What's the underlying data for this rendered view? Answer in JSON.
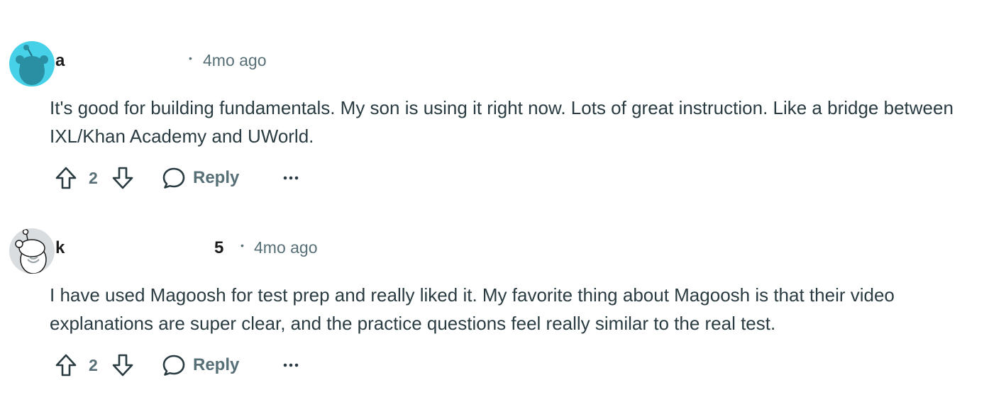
{
  "comments": [
    {
      "author_visible_start": "a",
      "author_visible_end": "",
      "separator": "•",
      "timestamp": "4mo ago",
      "body": "It's good for building fundamentals. My son is using it right now. Lots of great instruction. Like a bridge between IXL/Khan Academy and UWorld.",
      "vote_count": "2",
      "reply_label": "Reply",
      "more_label": "···",
      "avatar_color": "#46d1e8"
    },
    {
      "author_visible_start": "k",
      "author_visible_end": "5",
      "separator": "•",
      "timestamp": "4mo ago",
      "body": "I have used Magoosh for test prep and really liked it. My favorite thing about Magoosh is that their video explanations are super clear, and the practice questions feel really similar to the real test.",
      "vote_count": "2",
      "reply_label": "Reply",
      "more_label": "···",
      "avatar_color": "#d9dde0"
    }
  ],
  "colors": {
    "meta_text": "#576f76",
    "body_text": "#2a3c42",
    "background": "#ffffff"
  },
  "icons": [
    "upvote-icon",
    "downvote-icon",
    "reply-bubble-icon",
    "more-options-icon"
  ]
}
